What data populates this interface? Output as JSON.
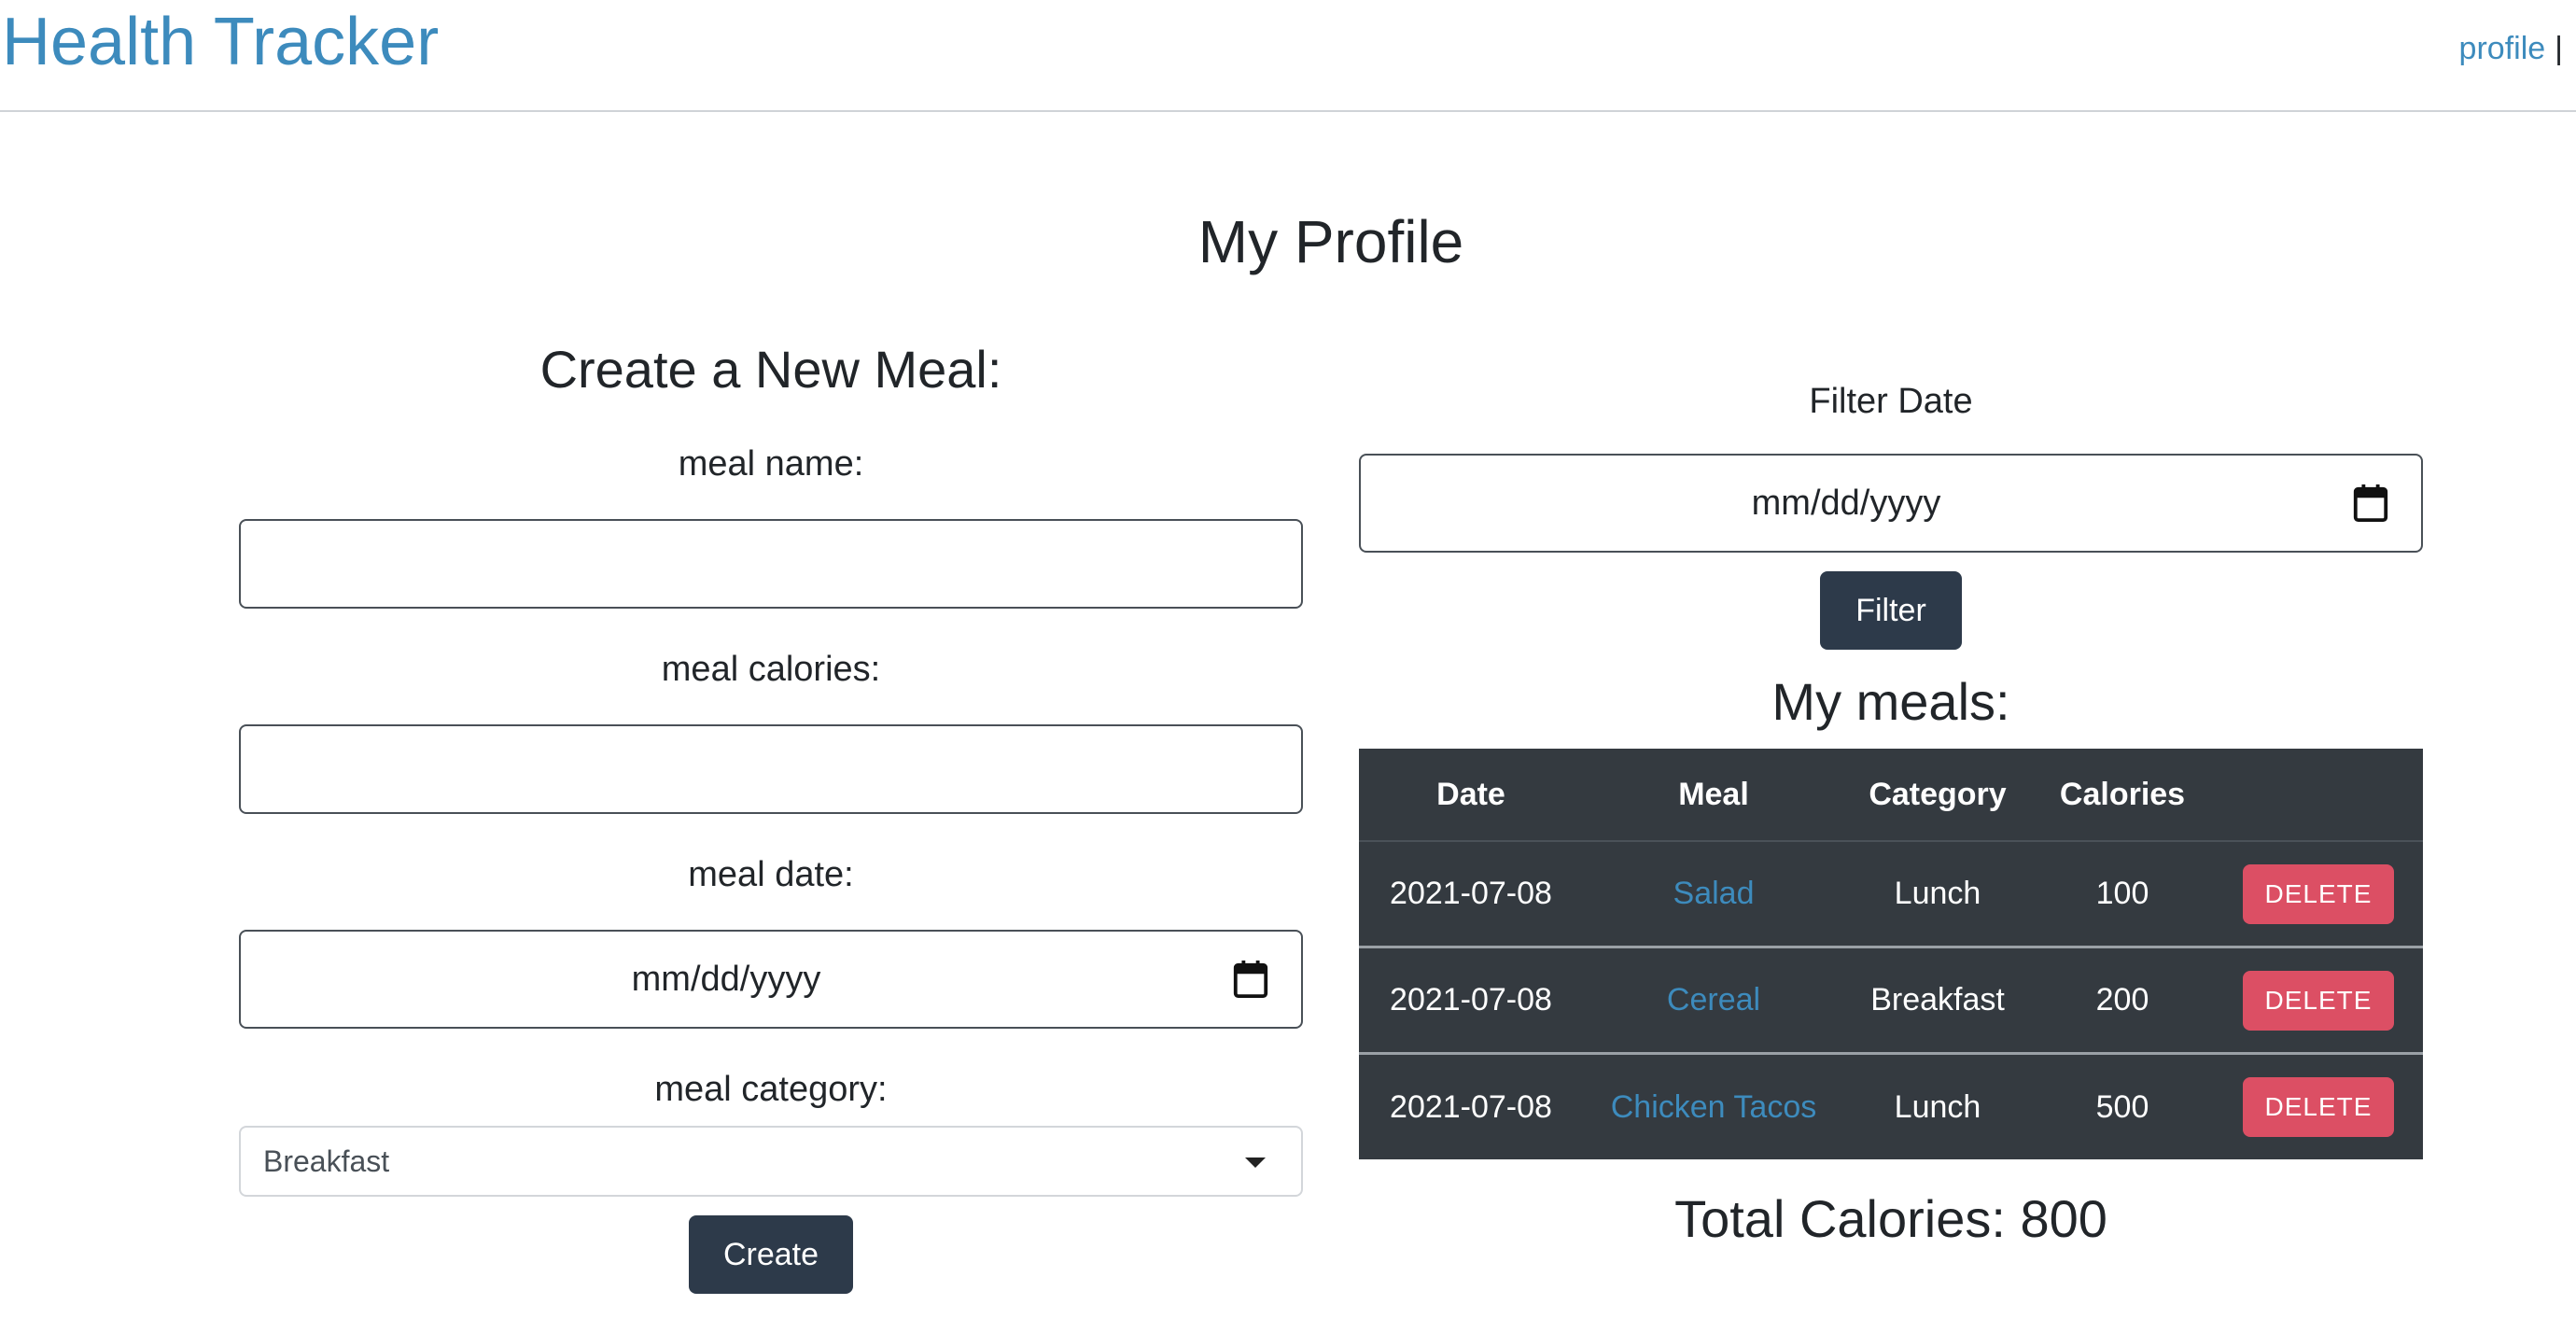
{
  "header": {
    "brand": "Health Tracker",
    "profile_link": "profile",
    "separator": "|"
  },
  "page": {
    "title": "My Profile"
  },
  "create_form": {
    "title": "Create a New Meal:",
    "name_label": "meal name:",
    "name_value": "",
    "calories_label": "meal calories:",
    "calories_value": "",
    "date_label": "meal date:",
    "date_placeholder": "mm/dd/yyyy",
    "category_label": "meal category:",
    "category_selected": "Breakfast",
    "create_button": "Create"
  },
  "filter": {
    "label": "Filter Date",
    "date_placeholder": "mm/dd/yyyy",
    "button": "Filter"
  },
  "meals": {
    "title": "My meals:",
    "columns": [
      "Date",
      "Meal",
      "Category",
      "Calories",
      ""
    ],
    "rows": [
      {
        "date": "2021-07-08",
        "meal": "Salad",
        "category": "Lunch",
        "calories": "100",
        "action": "DELETE"
      },
      {
        "date": "2021-07-08",
        "meal": "Cereal",
        "category": "Breakfast",
        "calories": "200",
        "action": "DELETE"
      },
      {
        "date": "2021-07-08",
        "meal": "Chicken Tacos",
        "category": "Lunch",
        "calories": "500",
        "action": "DELETE"
      }
    ],
    "total_label": "Total Calories: 800"
  },
  "colors": {
    "link": "#3d8bbd",
    "button_dark": "#2d3a4a",
    "table_bg": "#343a40",
    "delete": "#dc4f64"
  },
  "icons": {
    "date_picker": "calendar-icon",
    "select": "chevron-down-icon"
  }
}
